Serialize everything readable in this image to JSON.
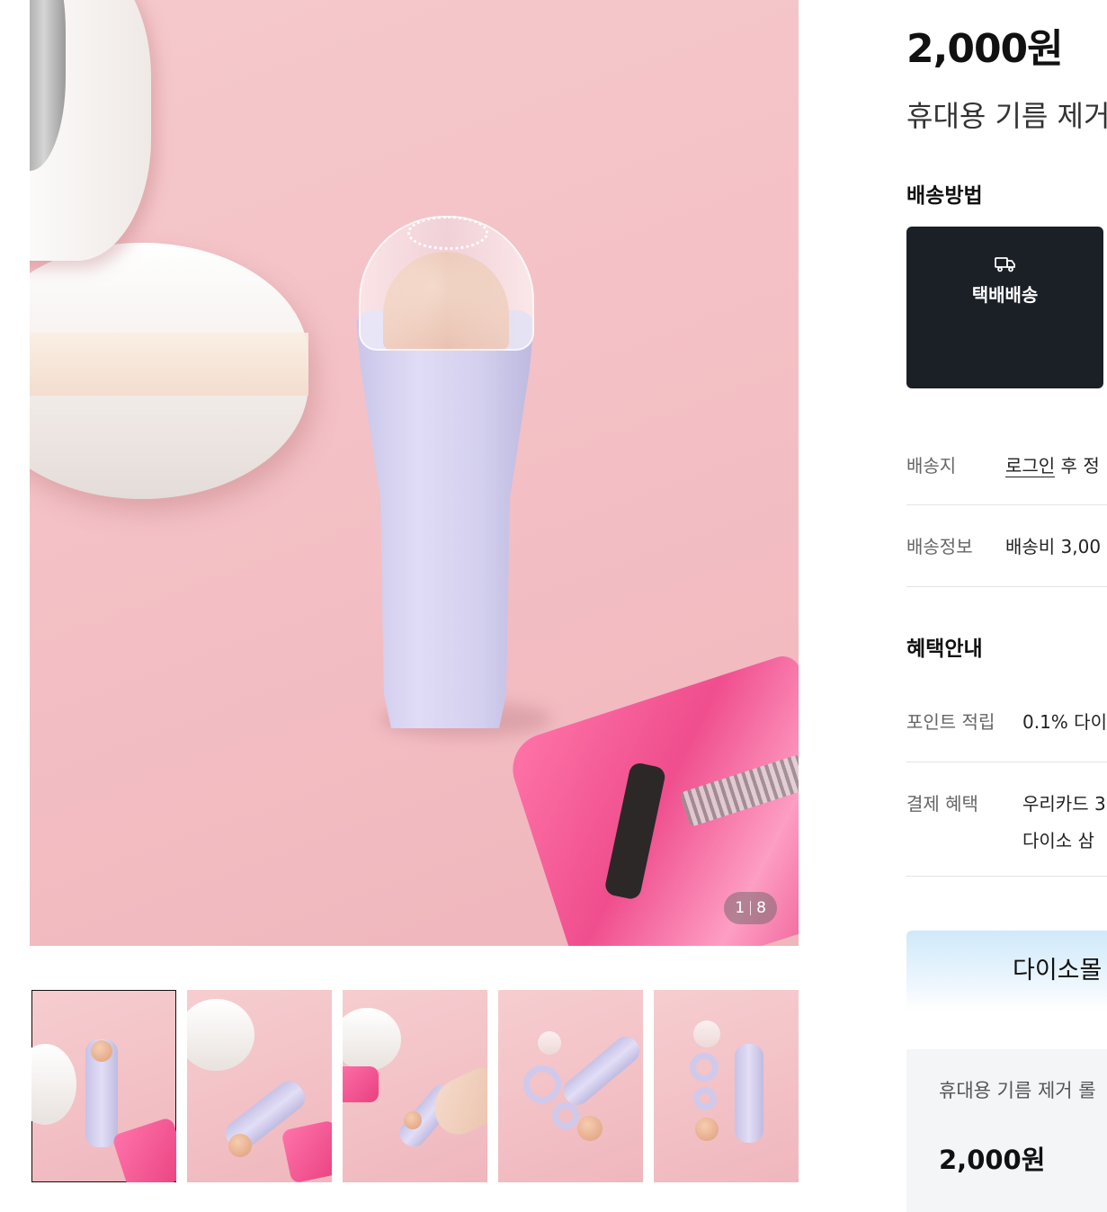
{
  "gallery": {
    "counter": {
      "current": "1",
      "total": "8"
    },
    "thumbnails": [
      {
        "label": "thumbnail-1",
        "active": true
      },
      {
        "label": "thumbnail-2",
        "active": false
      },
      {
        "label": "thumbnail-3",
        "active": false
      },
      {
        "label": "thumbnail-4",
        "active": false
      },
      {
        "label": "thumbnail-5",
        "active": false
      }
    ]
  },
  "product": {
    "price": "2,000원",
    "title": "휴대용 기름 제거 롤러"
  },
  "shipping": {
    "section_title": "배송방법",
    "method": {
      "icon": "truck-icon",
      "label": "택배배송"
    },
    "address": {
      "key": "배송지",
      "link": "로그인",
      "text": " 후 정"
    },
    "info": {
      "key": "배송정보",
      "value": "배송비 3,00"
    }
  },
  "benefits": {
    "section_title": "혜택안내",
    "points": {
      "key": "포인트 적립",
      "value": "0.1% 다이"
    },
    "payment": {
      "key": "결제 혜택",
      "line1": "우리카드 3",
      "line2": "다이소 삼"
    }
  },
  "banner": {
    "text": "다이소몰"
  },
  "summary": {
    "name": "휴대용 기름 제거 롤",
    "price": "2,000원"
  },
  "colors": {
    "dark_card": "#1b1f26",
    "summary_bg": "#f4f5f7",
    "banner_blue": "#cfe9fa"
  }
}
